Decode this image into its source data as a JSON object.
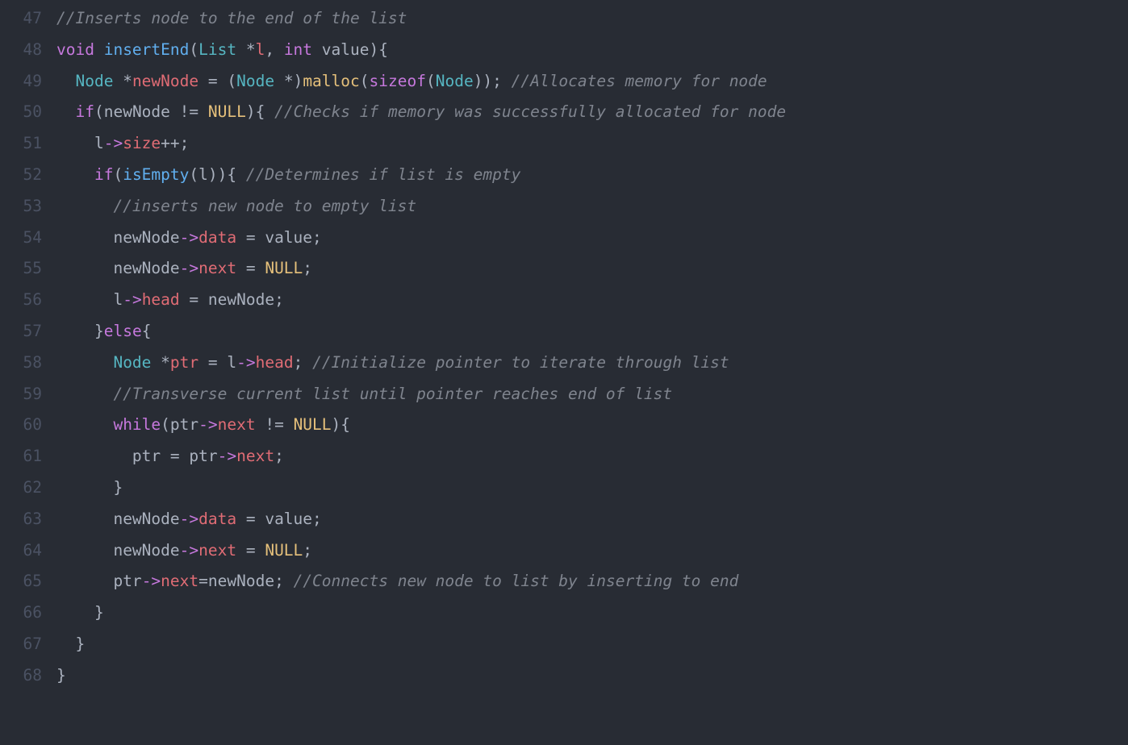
{
  "lineNumbers": [
    "47",
    "48",
    "49",
    "50",
    "51",
    "52",
    "53",
    "54",
    "55",
    "56",
    "57",
    "58",
    "59",
    "60",
    "61",
    "62",
    "63",
    "64",
    "65",
    "66",
    "67",
    "68"
  ],
  "code": {
    "l47_c1": "//Inserts node to the end of the list",
    "l48_k1": "void",
    "l48_f1": " insertEnd",
    "l48_p1": "(",
    "l48_t1": "List",
    "l48_o1": " *",
    "l48_v1": "l",
    "l48_p2": ", ",
    "l48_k2": "int",
    "l48_v2": " value",
    "l48_p3": ")",
    "l48_b1": "{",
    "l49_i": "  ",
    "l49_t1": "Node",
    "l49_o1": " *",
    "l49_v1": "newNode",
    "l49_o2": " = ",
    "l49_p1": "(",
    "l49_t2": "Node",
    "l49_o3": " *",
    "l49_p2": ")",
    "l49_f1": "malloc",
    "l49_p3": "(",
    "l49_k1": "sizeof",
    "l49_p4": "(",
    "l49_t3": "Node",
    "l49_p5": "))",
    "l49_s": ";",
    "l49_sp": " ",
    "l49_c1": "//Allocates memory for node",
    "l50_i": "  ",
    "l50_k1": "if",
    "l50_p1": "(",
    "l50_v1": "newNode",
    "l50_o1": " != ",
    "l50_n1": "NULL",
    "l50_p2": ")",
    "l50_b1": "{",
    "l50_sp": " ",
    "l50_c1": "//Checks if memory was successfully allocated for node",
    "l51_i": "    ",
    "l51_v1": "l",
    "l51_ar": "->",
    "l51_v2": "size",
    "l51_o1": "++",
    "l51_s": ";",
    "l52_i": "    ",
    "l52_k1": "if",
    "l52_p1": "(",
    "l52_f1": "isEmpty",
    "l52_p2": "(",
    "l52_v1": "l",
    "l52_p3": "))",
    "l52_b1": "{",
    "l52_sp": " ",
    "l52_c1": "//Determines if list is empty",
    "l53_i": "      ",
    "l53_c1": "//inserts new node to empty list",
    "l54_i": "      ",
    "l54_v1": "newNode",
    "l54_ar": "->",
    "l54_v2": "data",
    "l54_o1": " = ",
    "l54_v3": "value",
    "l54_s": ";",
    "l55_i": "      ",
    "l55_v1": "newNode",
    "l55_ar": "->",
    "l55_v2": "next",
    "l55_o1": " = ",
    "l55_n1": "NULL",
    "l55_s": ";",
    "l56_i": "      ",
    "l56_v1": "l",
    "l56_ar": "->",
    "l56_v2": "head",
    "l56_o1": " = ",
    "l56_v3": "newNode",
    "l56_s": ";",
    "l57_i": "    ",
    "l57_b1": "}",
    "l57_k1": "else",
    "l57_b2": "{",
    "l58_i": "      ",
    "l58_t1": "Node",
    "l58_o1": " *",
    "l58_v1": "ptr",
    "l58_o2": " = ",
    "l58_v2": "l",
    "l58_ar": "->",
    "l58_v3": "head",
    "l58_s": ";",
    "l58_sp": " ",
    "l58_c1": "//Initialize pointer to iterate through list",
    "l59_i": "      ",
    "l59_c1": "//Transverse current list until pointer reaches end of list",
    "l60_i": "      ",
    "l60_k1": "while",
    "l60_p1": "(",
    "l60_v1": "ptr",
    "l60_ar": "->",
    "l60_v2": "next",
    "l60_o1": " != ",
    "l60_n1": "NULL",
    "l60_p2": ")",
    "l60_b1": "{",
    "l61_i": "        ",
    "l61_v1": "ptr",
    "l61_o1": " = ",
    "l61_v2": "ptr",
    "l61_ar": "->",
    "l61_v3": "next",
    "l61_s": ";",
    "l62_i": "      ",
    "l62_b1": "}",
    "l63_i": "      ",
    "l63_v1": "newNode",
    "l63_ar": "->",
    "l63_v2": "data",
    "l63_o1": " = ",
    "l63_v3": "value",
    "l63_s": ";",
    "l64_i": "      ",
    "l64_v1": "newNode",
    "l64_ar": "->",
    "l64_v2": "next",
    "l64_o1": " = ",
    "l64_n1": "NULL",
    "l64_s": ";",
    "l65_i": "      ",
    "l65_v1": "ptr",
    "l65_ar": "->",
    "l65_v2": "next",
    "l65_o1": "=",
    "l65_v3": "newNode",
    "l65_s": ";",
    "l65_sp": " ",
    "l65_c1": "//Connects new node to list by inserting to end",
    "l66_i": "    ",
    "l66_b1": "}",
    "l67_i": "  ",
    "l67_b1": "}",
    "l68_b1": "}"
  }
}
